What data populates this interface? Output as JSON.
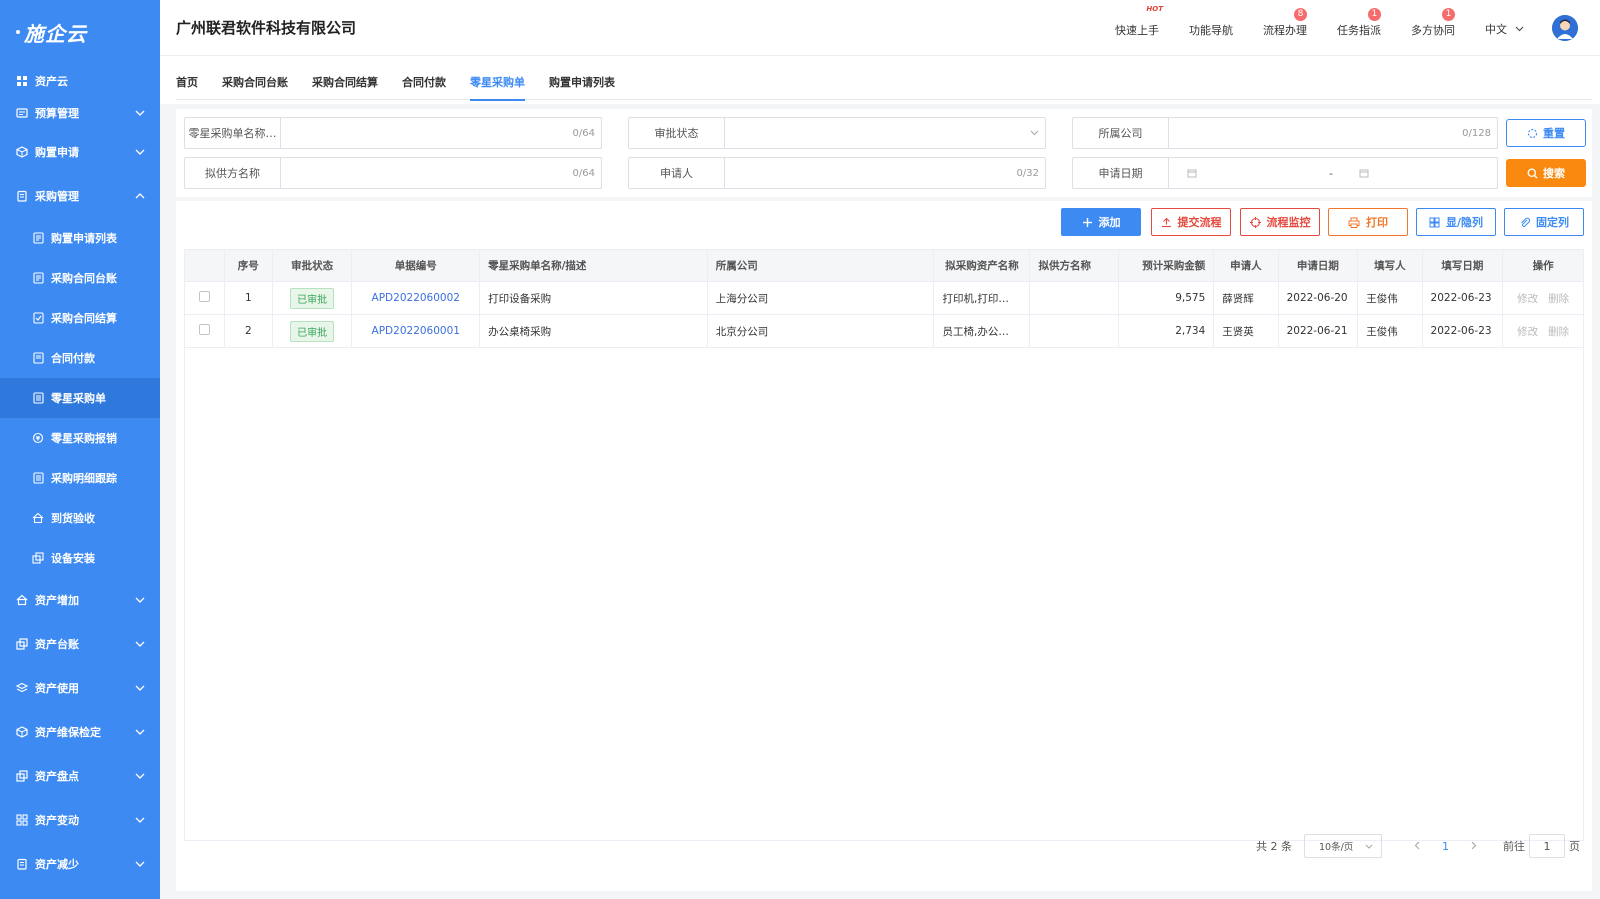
{
  "app": {
    "logo": "施企云",
    "company": "广州联君软件科技有限公司"
  },
  "header": {
    "items": [
      {
        "label": "快速上手",
        "tag": "HOT"
      },
      {
        "label": "功能导航"
      },
      {
        "label": "流程办理",
        "badge": "8"
      },
      {
        "label": "任务指派",
        "badge": "1"
      },
      {
        "label": "多方协同",
        "badge": "1"
      }
    ],
    "language": "中文"
  },
  "sidebar": {
    "top": "资产云",
    "groups": [
      {
        "label": "预算管理",
        "icon": "budget-icon",
        "expanded": false
      },
      {
        "label": "购置申请",
        "icon": "cube-icon",
        "expanded": false
      },
      {
        "label": "采购管理",
        "icon": "clipboard-icon",
        "expanded": true
      },
      {
        "label": "资产增加",
        "icon": "house-icon",
        "expanded": false
      },
      {
        "label": "资产台账",
        "icon": "stack-icon",
        "expanded": false
      },
      {
        "label": "资产使用",
        "icon": "layers-icon",
        "expanded": false
      },
      {
        "label": "资产维保检定",
        "icon": "cube-icon",
        "expanded": false
      },
      {
        "label": "资产盘点",
        "icon": "stack-icon",
        "expanded": false
      },
      {
        "label": "资产变动",
        "icon": "grid-icon",
        "expanded": false
      },
      {
        "label": "资产减少",
        "icon": "clipboard-icon",
        "expanded": false
      }
    ],
    "sub_items": [
      {
        "label": "购置申请列表",
        "icon": "list-doc-icon"
      },
      {
        "label": "采购合同台账",
        "icon": "list-doc-icon"
      },
      {
        "label": "采购合同结算",
        "icon": "doc-check-icon"
      },
      {
        "label": "合同付款",
        "icon": "list-doc-icon"
      },
      {
        "label": "零星采购单",
        "icon": "list-doc-icon",
        "active": true
      },
      {
        "label": "零星采购报销",
        "icon": "coin-icon"
      },
      {
        "label": "采购明细跟踪",
        "icon": "list-doc-icon"
      },
      {
        "label": "到货验收",
        "icon": "house-icon"
      },
      {
        "label": "设备安装",
        "icon": "stack-icon"
      }
    ]
  },
  "tabs": [
    {
      "label": "首页"
    },
    {
      "label": "采购合同台账"
    },
    {
      "label": "采购合同结算"
    },
    {
      "label": "合同付款"
    },
    {
      "label": "零星采购单",
      "active": true
    },
    {
      "label": "购置申请列表"
    }
  ],
  "filters": {
    "name": {
      "label": "零星采购单名称…",
      "count": "0/64"
    },
    "status": {
      "label": "审批状态"
    },
    "company": {
      "label": "所属公司",
      "count": "0/128"
    },
    "supplier": {
      "label": "拟供方名称",
      "count": "0/64"
    },
    "applicant": {
      "label": "申请人",
      "count": "0/32"
    },
    "date": {
      "label": "申请日期",
      "separator": "-"
    },
    "reset_label": "重置",
    "search_label": "搜索"
  },
  "toolbar": {
    "add": "添加",
    "submit": "提交流程",
    "monitor": "流程监控",
    "print": "打印",
    "toggle_cols": "显/隐列",
    "pin_cols": "固定列"
  },
  "table": {
    "headers": [
      "序号",
      "审批状态",
      "单据编号",
      "零星采购单名称/描述",
      "所属公司",
      "拟采购资产名称",
      "拟供方名称",
      "预计采购金额",
      "申请人",
      "申请日期",
      "填写人",
      "填写日期",
      "操作"
    ],
    "rows": [
      {
        "no": "1",
        "status": "已审批",
        "code": "APD2022060002",
        "name": "打印设备采购",
        "company": "上海分公司",
        "asset": "打印机,打印…",
        "supplier": "",
        "amount": "9,575",
        "applicant": "薛贤辉",
        "apply_date": "2022-06-20",
        "writer": "王俊伟",
        "write_date": "2022-06-23",
        "edit": "修改",
        "delete": "删除"
      },
      {
        "no": "2",
        "status": "已审批",
        "code": "APD2022060001",
        "name": "办公桌椅采购",
        "company": "北京分公司",
        "asset": "员工椅,办公…",
        "supplier": "",
        "amount": "2,734",
        "applicant": "王贤英",
        "apply_date": "2022-06-21",
        "writer": "王俊伟",
        "write_date": "2022-06-23",
        "edit": "修改",
        "delete": "删除"
      }
    ]
  },
  "pager": {
    "total": "共 2 条",
    "page_size": "10条/页",
    "current": "1",
    "goto_prefix": "前往",
    "goto_value": "1",
    "goto_suffix": "页"
  },
  "colors": {
    "sidebar": "#3d8bf2",
    "primary": "#3d8bf2",
    "search": "#f98a0f",
    "danger": "#e44a3f"
  }
}
